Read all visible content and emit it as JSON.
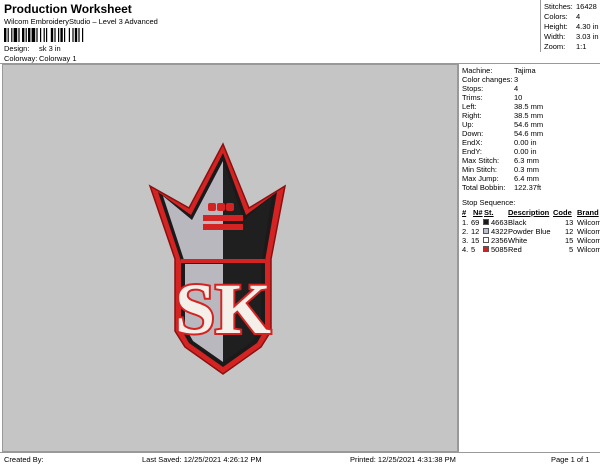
{
  "header": {
    "title": "Production Worksheet",
    "subtitle": "Wilcom EmbroideryStudio – Level 3 Advanced",
    "design_label": "Design:",
    "design_value": "sk 3 in",
    "colorway_label": "Colorway:",
    "colorway_value": "Colorway 1"
  },
  "stats": [
    {
      "label": "Stitches:",
      "value": "16428"
    },
    {
      "label": "Colors:",
      "value": "4"
    },
    {
      "label": "Height:",
      "value": "4.30 in"
    },
    {
      "label": "Width:",
      "value": "3.03 in"
    },
    {
      "label": "Zoom:",
      "value": "1:1"
    }
  ],
  "info": [
    {
      "label": "Machine:",
      "value": "Tajima"
    },
    {
      "label": "Color changes:",
      "value": "3"
    },
    {
      "label": "Stops:",
      "value": "4"
    },
    {
      "label": "Trims:",
      "value": "10"
    },
    {
      "label": "Left:",
      "value": "38.5 mm"
    },
    {
      "label": "Right:",
      "value": "38.5 mm"
    },
    {
      "label": "Up:",
      "value": "54.6 mm"
    },
    {
      "label": "Down:",
      "value": "54.6 mm"
    },
    {
      "label": "EndX:",
      "value": "0.00 in"
    },
    {
      "label": "EndY:",
      "value": "0.00 in"
    },
    {
      "label": "Max Stitch:",
      "value": "6.3 mm"
    },
    {
      "label": "Min Stitch:",
      "value": "0.3 mm"
    },
    {
      "label": "Max Jump:",
      "value": "6.4 mm"
    },
    {
      "label": "Total Bobbin:",
      "value": "122.37ft"
    }
  ],
  "stop_sequence": {
    "title": "Stop Sequence:",
    "headers": [
      "#",
      "N#",
      "St.",
      "Description",
      "Code",
      "Brand"
    ],
    "rows": [
      {
        "num": "1.",
        "n": "69",
        "color": "#1a1a1a",
        "st": "4663",
        "desc": "Black",
        "code": "13",
        "brand": "Wilcom"
      },
      {
        "num": "2.",
        "n": "12",
        "color": "#b8bfd0",
        "st": "4322",
        "desc": "Powder Blue",
        "code": "12",
        "brand": "Wilcom"
      },
      {
        "num": "3.",
        "n": "15",
        "color": "#ffffff",
        "st": "2356",
        "desc": "White",
        "code": "15",
        "brand": "Wilcom"
      },
      {
        "num": "4.",
        "n": "5",
        "color": "#d42323",
        "st": "5085",
        "desc": "Red",
        "code": "5",
        "brand": "Wilcom"
      }
    ]
  },
  "footer": {
    "created": "Created By:",
    "saved": "Last Saved: 12/25/2021 4:26:12 PM",
    "printed": "Printed: 12/25/2021 4:31:38 PM",
    "page": "Page 1 of 1"
  },
  "design": {
    "letters": "SK",
    "colors": {
      "red": "#d42323",
      "black": "#1a1a1a",
      "grey": "#b8b8be",
      "white": "#f4efe8"
    }
  }
}
